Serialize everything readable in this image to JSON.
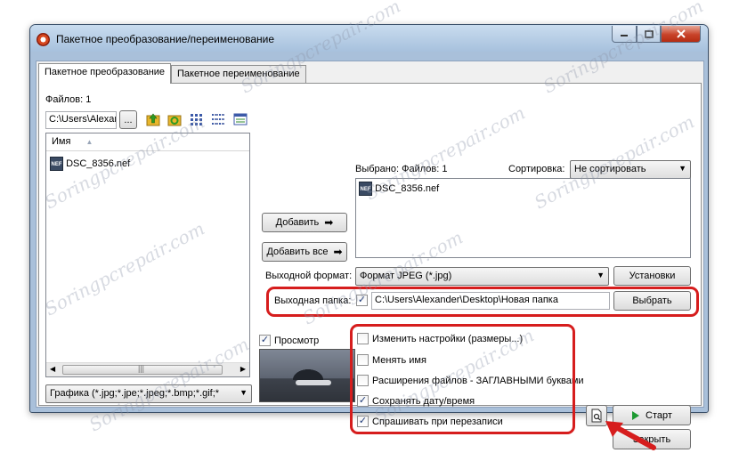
{
  "window": {
    "title": "Пакетное преобразование/переименование"
  },
  "tabs": [
    {
      "label": "Пакетное преобразование",
      "active": true
    },
    {
      "label": "Пакетное переименование",
      "active": false
    }
  ],
  "source": {
    "files_count_label": "Файлов: 1",
    "path_value": "C:\\Users\\Alexar",
    "browse_label": "...",
    "list_header": "Имя",
    "files": [
      "DSC_8356.nef"
    ],
    "filter_value": "Графика (*.jpg;*.jpe;*.jpeg;*.bmp;*.gif;*"
  },
  "actions": {
    "add_label": "Добавить",
    "add_all_label": "Добавить все"
  },
  "selected": {
    "label": "Выбрано: Файлов: 1",
    "files": [
      "DSC_8356.nef"
    ]
  },
  "sort": {
    "label": "Сортировка:",
    "value": "Не сортировать"
  },
  "output_format": {
    "label": "Выходной формат:",
    "value": "Формат JPEG (*.jpg)",
    "settings_label": "Установки"
  },
  "output_folder": {
    "label": "Выходная папка:",
    "path": "C:\\Users\\Alexander\\Desktop\\Новая папка",
    "browse_label": "Выбрать"
  },
  "preview": {
    "label": "Просмотр"
  },
  "options": [
    {
      "label": "Изменить настройки (размеры...)",
      "checked": false
    },
    {
      "label": "Менять имя",
      "checked": false
    },
    {
      "label": "Расширения файлов - ЗАГЛАВНЫМИ буквами",
      "checked": false
    },
    {
      "label": "Сохранять дату/время",
      "checked": true
    },
    {
      "label": "Спрашивать при перезаписи",
      "checked": true
    }
  ],
  "buttons": {
    "start_label": "Старт",
    "close_label": "Закрыть"
  },
  "watermark": "Soringpcrepair.com",
  "colors": {
    "highlight": "#d61d1d",
    "start_icon": "#1d9a32"
  }
}
